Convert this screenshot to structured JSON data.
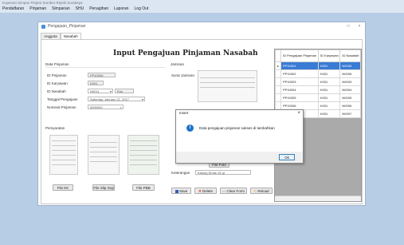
{
  "app": {
    "title": "Koperasi Simpan Pinjam Sumber Rejeki Surabaya",
    "menu": [
      "Pendaftaran",
      "Pinjaman",
      "Simpanan",
      "SHU",
      "Penagihan",
      "Laporan",
      "Log Out"
    ]
  },
  "window": {
    "title": "Pengajuan_Pinjaman",
    "tabs": [
      "Anggota",
      "Nasabah"
    ],
    "controls": {
      "maximize": "□",
      "close": "×"
    }
  },
  "form": {
    "heading": "Input Pengajuan Pinjaman Nasabah",
    "section_data": "Data Pinjaman",
    "section_jaminan": "Jaminan",
    "section_persyaratan": "Persyaratan",
    "fields": {
      "id_pinjaman": {
        "label": "ID Pinjaman",
        "value": "PP10006"
      },
      "id_karyawan": {
        "label": "ID Karyawan",
        "value": "K001"
      },
      "id_nasabah": {
        "label": "ID Nasabah",
        "value": "N0011",
        "extra": "Eris"
      },
      "tanggal": {
        "label": "Tanggal Pengajuan",
        "day": "Saturday",
        "month": "January",
        "date": "21, 2017"
      },
      "nominal": {
        "label": "Nominal Pinjaman",
        "value": "5000000"
      }
    },
    "surat_jaminan_label": "Surat Jaminan",
    "keterangan": {
      "label": "Keterangan",
      "value": "Kalung Emas 15 gr"
    },
    "buttons": {
      "file_ktp": "File KK",
      "file_slip": "File Slip Gaji",
      "file_pbb": "File PBB",
      "file_jaminan": "File Foto",
      "simpan": "Save",
      "delete": "Delete",
      "clear": "Clear Form",
      "reload": "Reload"
    }
  },
  "grid": {
    "columns": [
      "ID Pengajuan Pinjaman",
      "ID Karyawan",
      "ID Nasabah"
    ],
    "rows": [
      [
        "PP10001",
        "K001",
        "N0005"
      ],
      [
        "PP10002",
        "K001",
        "N0005"
      ],
      [
        "PP10003",
        "K001",
        "N0003"
      ],
      [
        "PP10004",
        "K001",
        "N0004"
      ],
      [
        "PP10005",
        "K001",
        "N0005"
      ],
      [
        "PP10006",
        "K001",
        "N0006"
      ],
      [
        "PP10007",
        "K001",
        "N0007"
      ]
    ],
    "selected_row": 0,
    "row_marker": "▸"
  },
  "dialog": {
    "title": "Insert",
    "message": "Data pengajuan pinjaman sukses di tambahkan",
    "ok": "Ok",
    "close": "×",
    "icon": "i"
  }
}
